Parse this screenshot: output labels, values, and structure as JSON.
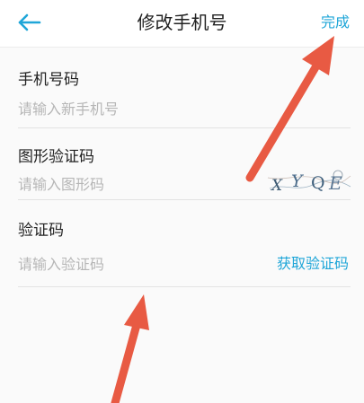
{
  "header": {
    "back_icon": "back-arrow-icon",
    "title": "修改手机号",
    "done_label": "完成"
  },
  "form": {
    "phone": {
      "label": "手机号码",
      "placeholder": "请输入新手机号"
    },
    "captcha": {
      "label": "图形验证码",
      "placeholder": "请输入图形码",
      "image_text": "XYQE"
    },
    "sms_code": {
      "label": "验证码",
      "placeholder": "请输入验证码",
      "get_code_label": "获取验证码"
    }
  },
  "colors": {
    "accent": "#1fa6d8",
    "annotation_arrow": "#e85a43"
  }
}
